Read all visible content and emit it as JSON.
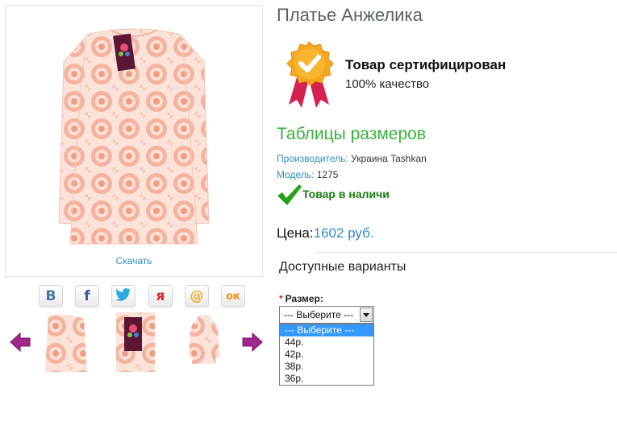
{
  "product": {
    "title": "Платье Анжелика",
    "download_label": "Скачать"
  },
  "certificate": {
    "title": "Товар сертифицирован",
    "subtitle": "100% качество"
  },
  "size_tables_link": "Таблицы размеров",
  "details": {
    "manufacturer_label": "Производитель:",
    "manufacturer_value": "Украина Tashkan",
    "model_label": "Модель:",
    "model_value": "1275",
    "stock_status": "Товар в наличи"
  },
  "price": {
    "label": "Цена:",
    "value": "1602 руб."
  },
  "variants": {
    "heading": "Доступные варианты",
    "size_required_mark": "*",
    "size_label": "Размер:",
    "selected": "--- Выберите ---",
    "options": [
      "--- Выберите ---",
      "44р.",
      "42р.",
      "38р.",
      "36р."
    ],
    "highlighted_index": 0
  },
  "share": [
    {
      "icon": "vk-icon",
      "glyph": "В",
      "color": "#4a76a8"
    },
    {
      "icon": "facebook-icon",
      "glyph": "f",
      "color": "#3b5998"
    },
    {
      "icon": "twitter-icon",
      "glyph": "🐦",
      "color": "#2aa9e0"
    },
    {
      "icon": "yaru-icon",
      "glyph": "я",
      "color": "#e0242a"
    },
    {
      "icon": "mailru-icon",
      "glyph": "@",
      "color": "#f5a623"
    },
    {
      "icon": "odnoklassniki-icon",
      "glyph": "ок",
      "color": "#f39019"
    }
  ],
  "colors": {
    "accent_blue": "#2d8fc4",
    "green": "#37b23b",
    "stock_green": "#1a7a16",
    "arrow_purple": "#a0288c",
    "dress_pink": "#f2a994"
  }
}
